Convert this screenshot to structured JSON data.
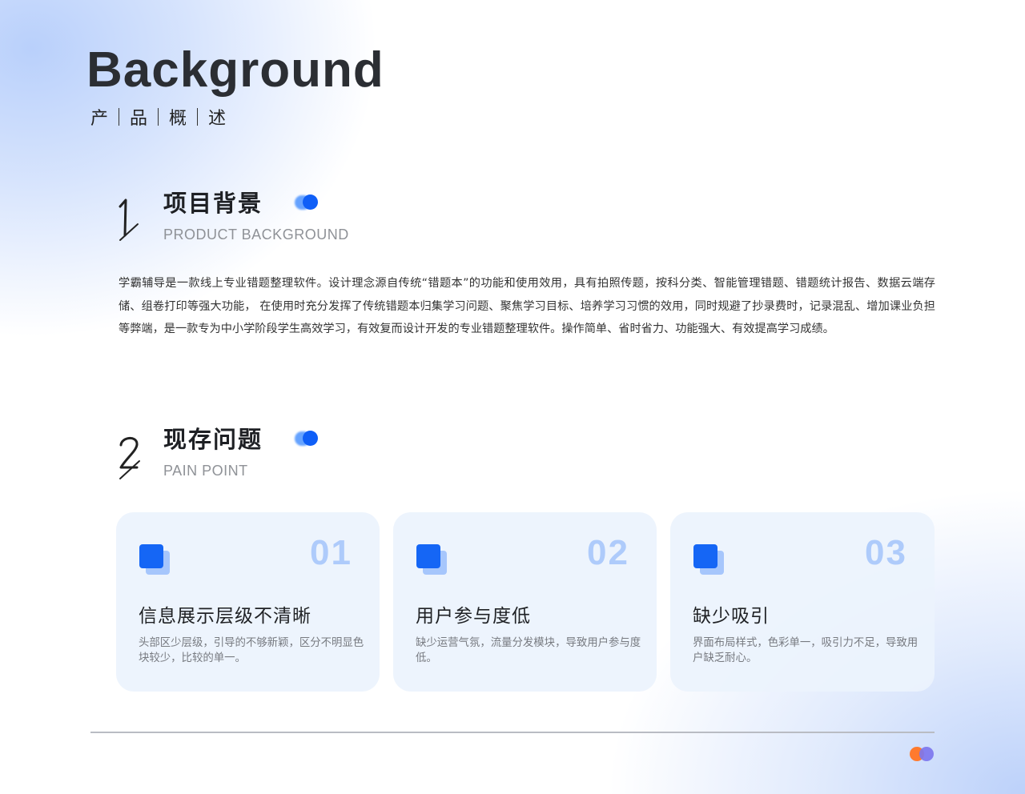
{
  "hero": {
    "title": "Background",
    "subtitle_chars": [
      "产",
      "品",
      "概",
      "述"
    ]
  },
  "sections": [
    {
      "number": "1",
      "title": "项目背景",
      "subtitle": "PRODUCT BACKGROUND"
    },
    {
      "number": "2",
      "title": "现存问题",
      "subtitle": "PAIN POINT"
    }
  ],
  "paragraph": "学霸辅导是一款线上专业错题整理软件。设计理念源自传统“错题本”的功能和使用效用，具有拍照传题，按科分类、智能管理错题、错题统计报告、数据云端存储、组卷打印等强大功能，  在使用时充分发挥了传统错题本归集学习问题、聚焦学习目标、培养学习习惯的效用，同时规避了抄录费时，记录混乱、增加课业负担等弊端，是一款专为中小学阶段学生高效学习，有效复而设计开发的专业错题整理软件。操作简单、省时省力、功能强大、有效提高学习成绩。",
  "cards": [
    {
      "num": "01",
      "title": "信息展示层级不清晰",
      "desc": "头部区少层级，引导的不够新颖，区分不明显色块较少，比较的单一。"
    },
    {
      "num": "02",
      "title": "用户参与度低",
      "desc": "缺少运营气氛，流量分发模块，导致用户参与度低。"
    },
    {
      "num": "03",
      "title": "缺少吸引",
      "desc": "界面布局样式，色彩单一，吸引力不足，导致用户缺乏耐心。"
    }
  ],
  "colors": {
    "accent_blue": "#1566f5",
    "card_number": "#aecbfb",
    "end_dot_orange": "#ff7a2e",
    "end_dot_purple": "#7d76ee"
  },
  "icons": [
    "stacked-squares-icon",
    "toggle-dots-icon"
  ]
}
